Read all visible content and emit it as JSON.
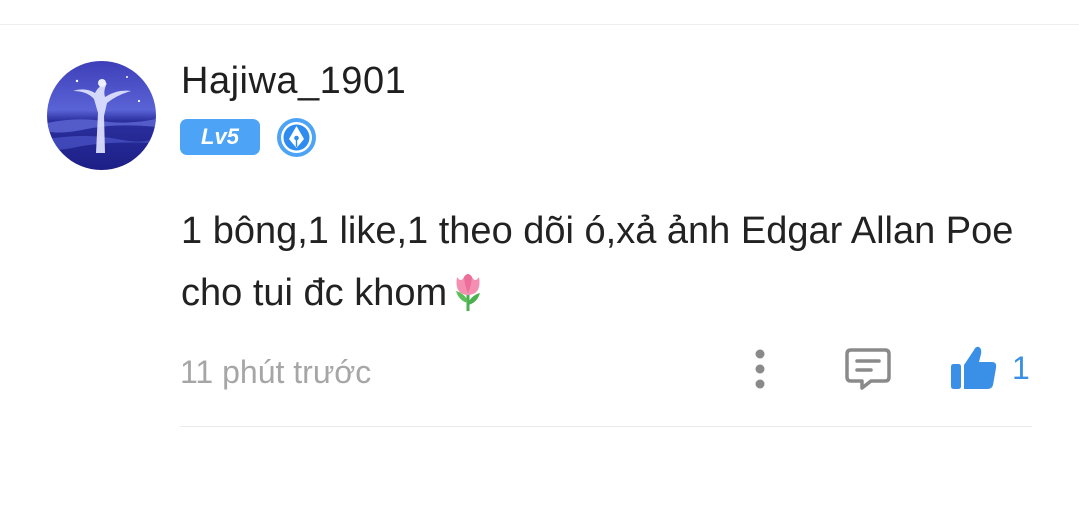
{
  "comment": {
    "user": {
      "name": "Hajiwa_1901",
      "level": "Lv5",
      "avatar_icon": "avatar-angel-statue-sea",
      "badge_icon": "pen-nib-badge-icon"
    },
    "text": "1 bông,1 like,1 theo dõi ó,xả ảnh Edgar Allan Poe cho tui đc khom",
    "emoji_icon": "tulip-icon",
    "timestamp": "11 phút trước",
    "actions": {
      "more_icon": "vertical-ellipsis-icon",
      "reply_icon": "comment-bubble-icon",
      "like_icon": "thumbs-up-icon",
      "like_count": "1"
    }
  },
  "colors": {
    "accent": "#4da3f5",
    "like_blue": "#3a8fe6",
    "timestamp_gray": "#a6a6a6",
    "icon_gray": "#8a8a8a",
    "text": "#222222"
  }
}
